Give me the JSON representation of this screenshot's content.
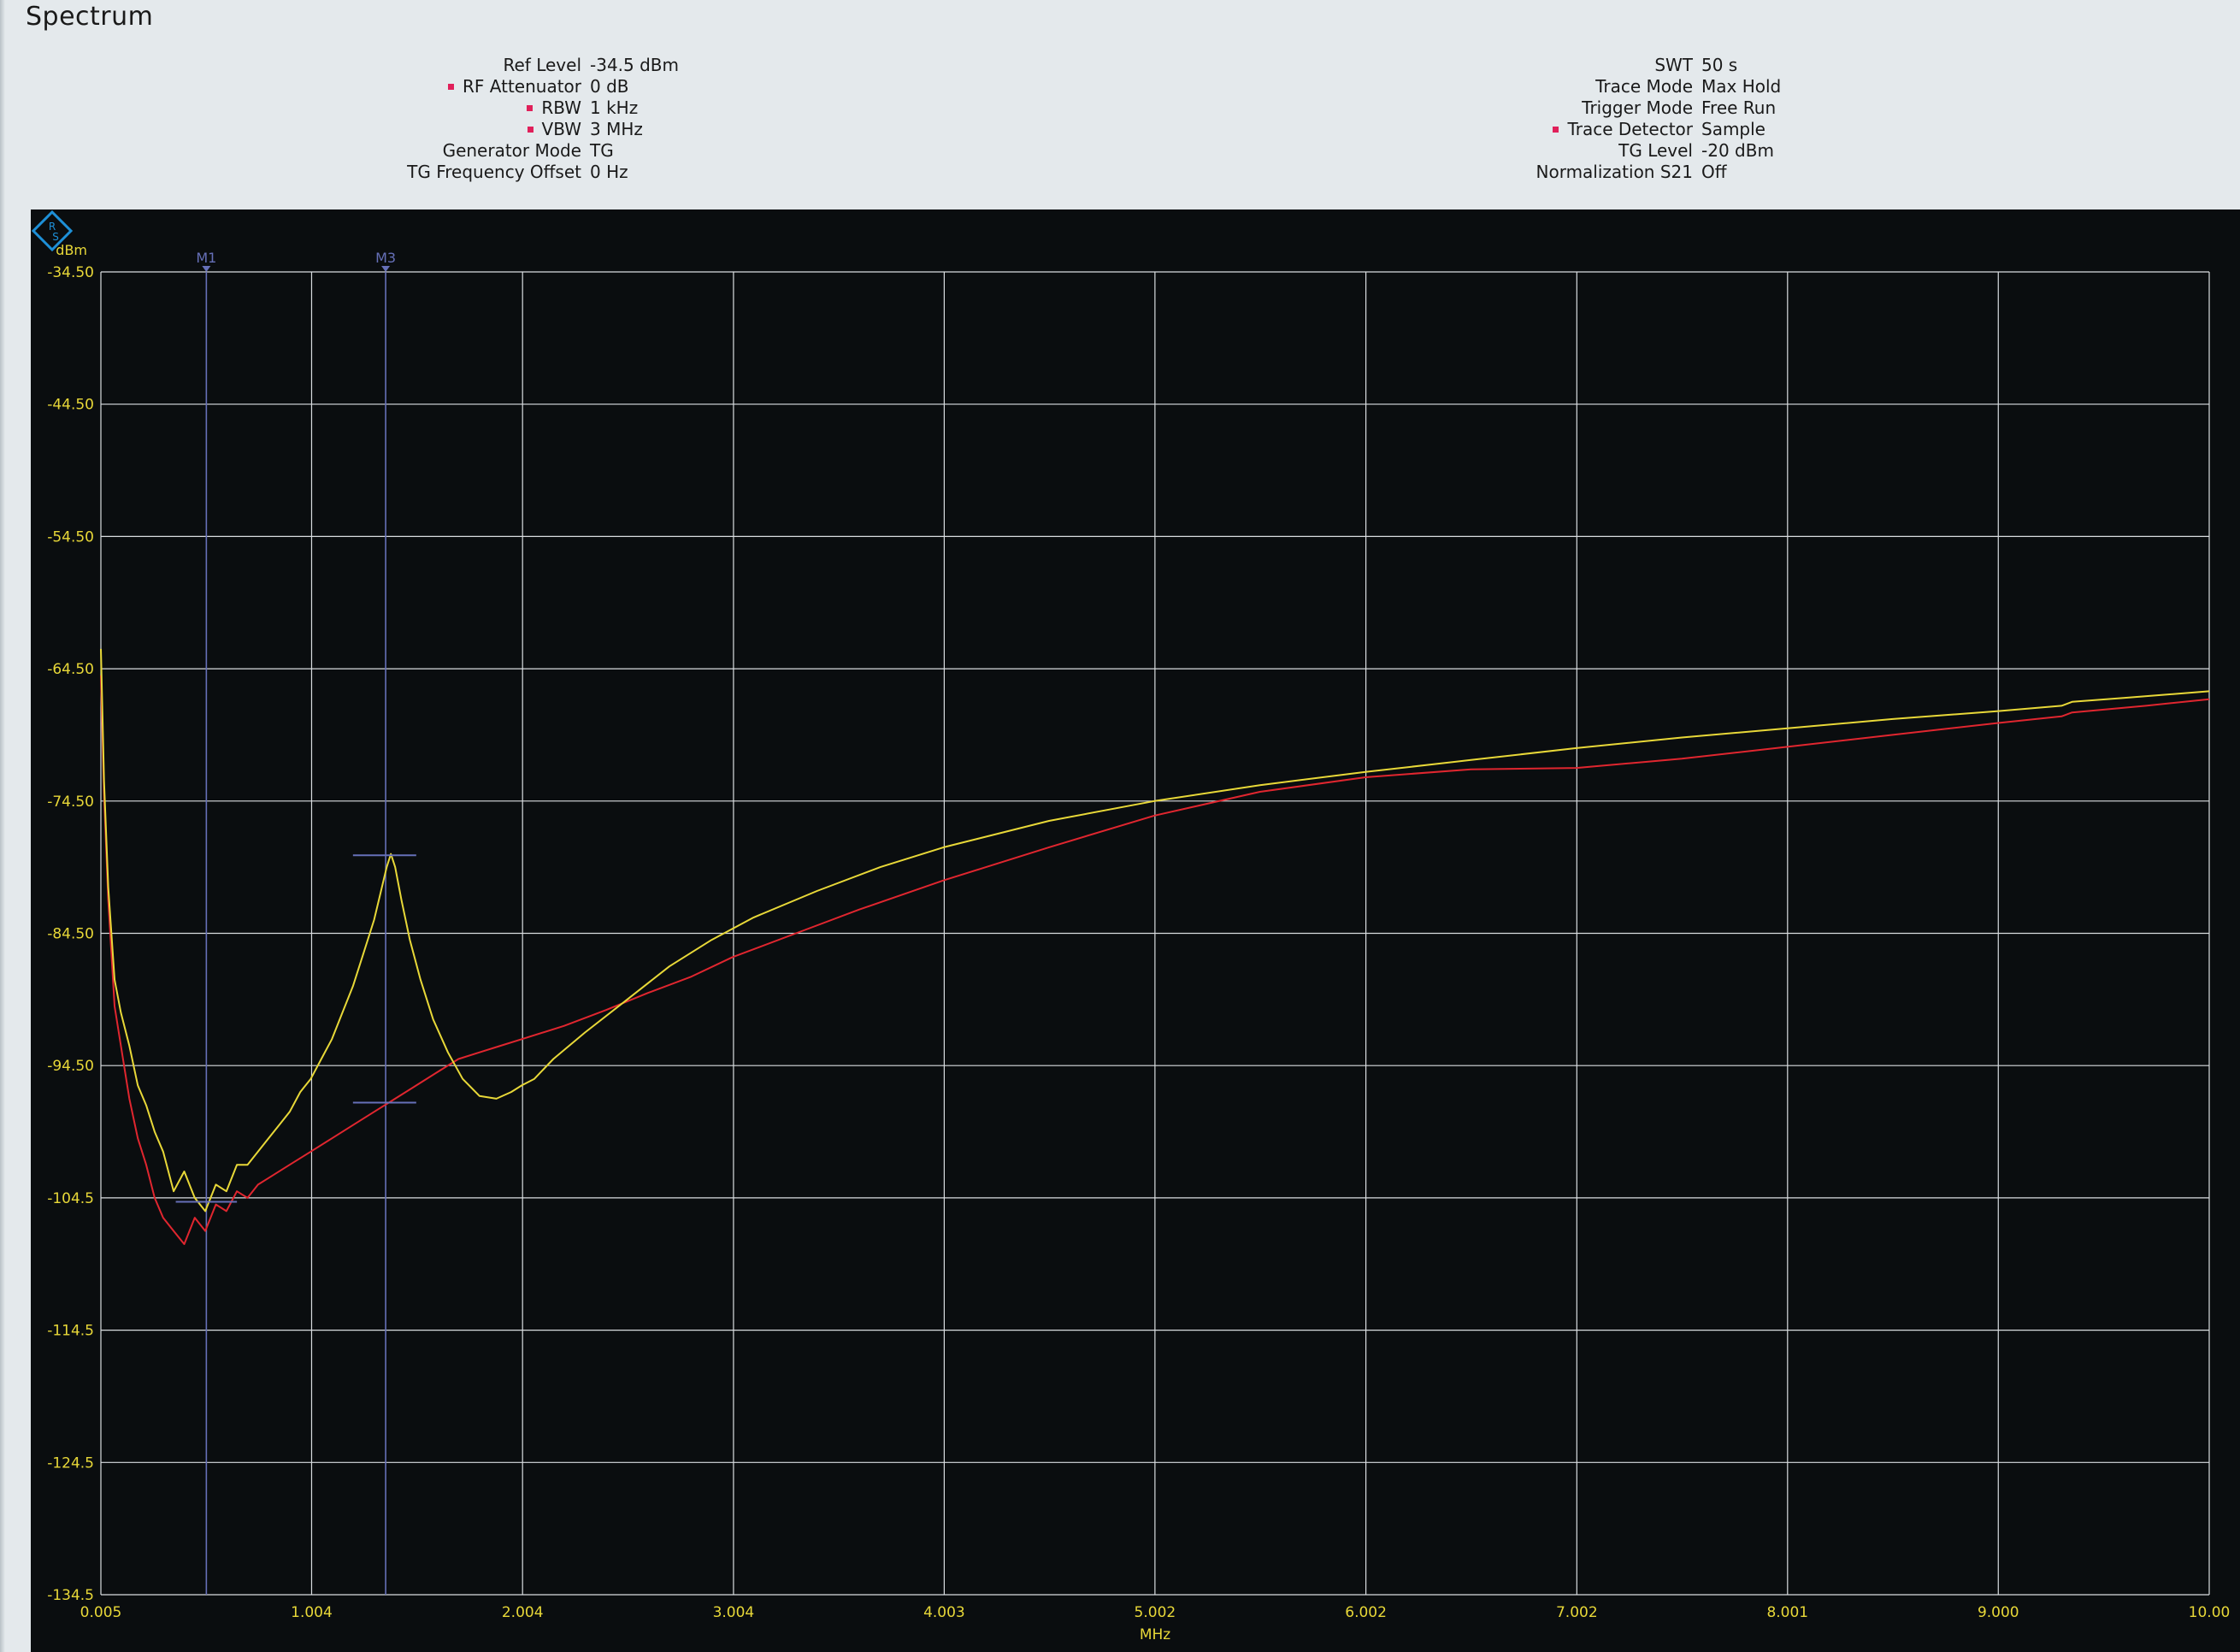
{
  "window": {
    "title": "Spectrum"
  },
  "settings_left": [
    {
      "label": "Ref Level",
      "value": "-34.5 dBm",
      "marked": false
    },
    {
      "label": "RF Attenuator",
      "value": "0 dB",
      "marked": true
    },
    {
      "label": "RBW",
      "value": "1 kHz",
      "marked": true
    },
    {
      "label": "VBW",
      "value": "3 MHz",
      "marked": true
    },
    {
      "label": "Generator Mode",
      "value": "TG",
      "marked": false
    },
    {
      "label": "TG Frequency Offset",
      "value": "0 Hz",
      "marked": false
    }
  ],
  "settings_right": [
    {
      "label": "SWT",
      "value": "50 s",
      "marked": false
    },
    {
      "label": "Trace Mode",
      "value": "Max Hold",
      "marked": false
    },
    {
      "label": "Trigger Mode",
      "value": "Free Run",
      "marked": false
    },
    {
      "label": "Trace Detector",
      "value": "Sample",
      "marked": true
    },
    {
      "label": "TG Level",
      "value": "-20 dBm",
      "marked": false
    },
    {
      "label": "Normalization S21",
      "value": "Off",
      "marked": false
    }
  ],
  "colors": {
    "background": "#0a0d0f",
    "grid": "#d9dde0",
    "yellow_trace": "#e8d838",
    "red_trace": "#e0262f",
    "marker": "#6670b8",
    "tick_label": "#e8d838",
    "marker_dot": "#e0205a",
    "logo": "#1e90d8"
  },
  "icons": {
    "logo": "rohde-schwarz-logo-icon",
    "marker_flag": "marker-triangle-icon"
  },
  "chart_data": {
    "type": "line",
    "ylabel": "dBm",
    "xlabel": "MHz",
    "xlim": [
      0.005,
      10.0
    ],
    "ylim": [
      -134.5,
      -34.5
    ],
    "x_tick_values": [
      0.005,
      1.004,
      2.004,
      3.004,
      4.003,
      5.002,
      6.002,
      7.002,
      8.001,
      9.0,
      10.0
    ],
    "x_tick_labels": [
      "0.005",
      "1.004",
      "2.004",
      "3.004",
      "4.003",
      "5.002",
      "6.002",
      "7.002",
      "8.001",
      "9.000",
      "10.00"
    ],
    "y_tick_values": [
      -34.5,
      -44.5,
      -54.5,
      -64.5,
      -74.5,
      -84.5,
      -94.5,
      -104.5,
      -114.5,
      -124.5,
      -134.5
    ],
    "y_tick_labels": [
      "-34.50",
      "-44.50",
      "-54.50",
      "-64.50",
      "-74.50",
      "-84.50",
      "-94.50",
      "-104.5",
      "-114.5",
      "-124.5",
      "-134.5"
    ],
    "grid": true,
    "series": [
      {
        "color": "#e8d838",
        "points": [
          [
            0.005,
            -63.0
          ],
          [
            0.02,
            -73.0
          ],
          [
            0.04,
            -81.0
          ],
          [
            0.07,
            -88.0
          ],
          [
            0.1,
            -90.5
          ],
          [
            0.14,
            -93.0
          ],
          [
            0.18,
            -96.0
          ],
          [
            0.22,
            -97.5
          ],
          [
            0.26,
            -99.5
          ],
          [
            0.3,
            -101.0
          ],
          [
            0.35,
            -104.0
          ],
          [
            0.4,
            -102.5
          ],
          [
            0.45,
            -104.5
          ],
          [
            0.5,
            -105.5
          ],
          [
            0.55,
            -103.5
          ],
          [
            0.6,
            -104.0
          ],
          [
            0.65,
            -102.0
          ],
          [
            0.7,
            -102.0
          ],
          [
            0.75,
            -101.0
          ],
          [
            0.8,
            -100.0
          ],
          [
            0.85,
            -99.0
          ],
          [
            0.9,
            -98.0
          ],
          [
            0.95,
            -96.5
          ],
          [
            1.0,
            -95.5
          ],
          [
            1.05,
            -94.0
          ],
          [
            1.1,
            -92.5
          ],
          [
            1.15,
            -90.5
          ],
          [
            1.2,
            -88.5
          ],
          [
            1.25,
            -86.0
          ],
          [
            1.3,
            -83.5
          ],
          [
            1.33,
            -81.5
          ],
          [
            1.36,
            -79.5
          ],
          [
            1.38,
            -78.5
          ],
          [
            1.4,
            -79.5
          ],
          [
            1.43,
            -82.0
          ],
          [
            1.47,
            -85.0
          ],
          [
            1.52,
            -88.0
          ],
          [
            1.58,
            -91.0
          ],
          [
            1.65,
            -93.5
          ],
          [
            1.72,
            -95.5
          ],
          [
            1.8,
            -96.8
          ],
          [
            1.88,
            -97.0
          ],
          [
            1.95,
            -96.5
          ],
          [
            2.0,
            -96.0
          ],
          [
            2.06,
            -95.5
          ],
          [
            2.15,
            -94.0
          ],
          [
            2.3,
            -92.0
          ],
          [
            2.5,
            -89.5
          ],
          [
            2.7,
            -87.0
          ],
          [
            2.9,
            -85.0
          ],
          [
            3.1,
            -83.3
          ],
          [
            3.4,
            -81.3
          ],
          [
            3.7,
            -79.5
          ],
          [
            4.0,
            -78.0
          ],
          [
            4.5,
            -76.0
          ],
          [
            5.0,
            -74.5
          ],
          [
            5.5,
            -73.3
          ],
          [
            6.0,
            -72.3
          ],
          [
            6.5,
            -71.4
          ],
          [
            7.0,
            -70.5
          ],
          [
            7.5,
            -69.7
          ],
          [
            8.0,
            -69.0
          ],
          [
            8.5,
            -68.3
          ],
          [
            9.0,
            -67.7
          ],
          [
            9.3,
            -67.3
          ],
          [
            9.35,
            -67.0
          ],
          [
            9.6,
            -66.7
          ],
          [
            10.0,
            -66.2
          ]
        ]
      },
      {
        "color": "#e0262f",
        "points": [
          [
            0.005,
            -65.0
          ],
          [
            0.02,
            -74.0
          ],
          [
            0.04,
            -82.0
          ],
          [
            0.07,
            -90.0
          ],
          [
            0.1,
            -93.0
          ],
          [
            0.14,
            -97.0
          ],
          [
            0.18,
            -100.0
          ],
          [
            0.22,
            -102.0
          ],
          [
            0.26,
            -104.5
          ],
          [
            0.3,
            -106.0
          ],
          [
            0.35,
            -107.0
          ],
          [
            0.4,
            -108.0
          ],
          [
            0.45,
            -106.0
          ],
          [
            0.5,
            -107.0
          ],
          [
            0.55,
            -105.0
          ],
          [
            0.6,
            -105.5
          ],
          [
            0.65,
            -104.0
          ],
          [
            0.7,
            -104.5
          ],
          [
            0.75,
            -103.5
          ],
          [
            0.8,
            -103.0
          ],
          [
            0.9,
            -102.0
          ],
          [
            1.0,
            -101.0
          ],
          [
            1.1,
            -100.0
          ],
          [
            1.2,
            -99.0
          ],
          [
            1.3,
            -98.0
          ],
          [
            1.4,
            -97.0
          ],
          [
            1.5,
            -96.0
          ],
          [
            1.6,
            -95.0
          ],
          [
            1.7,
            -94.0
          ],
          [
            1.8,
            -93.5
          ],
          [
            1.9,
            -93.0
          ],
          [
            2.0,
            -92.5
          ],
          [
            2.2,
            -91.5
          ],
          [
            2.4,
            -90.3
          ],
          [
            2.6,
            -89.0
          ],
          [
            2.8,
            -87.8
          ],
          [
            3.0,
            -86.3
          ],
          [
            3.3,
            -84.5
          ],
          [
            3.6,
            -82.7
          ],
          [
            4.0,
            -80.5
          ],
          [
            4.5,
            -78.0
          ],
          [
            5.0,
            -75.6
          ],
          [
            5.5,
            -73.8
          ],
          [
            6.0,
            -72.7
          ],
          [
            6.5,
            -72.1
          ],
          [
            7.0,
            -72.0
          ],
          [
            7.5,
            -71.3
          ],
          [
            8.0,
            -70.4
          ],
          [
            8.5,
            -69.5
          ],
          [
            9.0,
            -68.6
          ],
          [
            9.3,
            -68.1
          ],
          [
            9.35,
            -67.8
          ],
          [
            9.7,
            -67.3
          ],
          [
            10.0,
            -66.8
          ]
        ]
      }
    ],
    "markers": [
      {
        "label": "M1",
        "x": 0.505,
        "y": -104.8,
        "level_x_range": [
          0.36,
          0.65
        ]
      },
      {
        "label": "M3",
        "x": 1.355,
        "y": -78.6,
        "level_x_range": [
          1.2,
          1.5
        ],
        "ref_y": -97.3
      }
    ]
  }
}
